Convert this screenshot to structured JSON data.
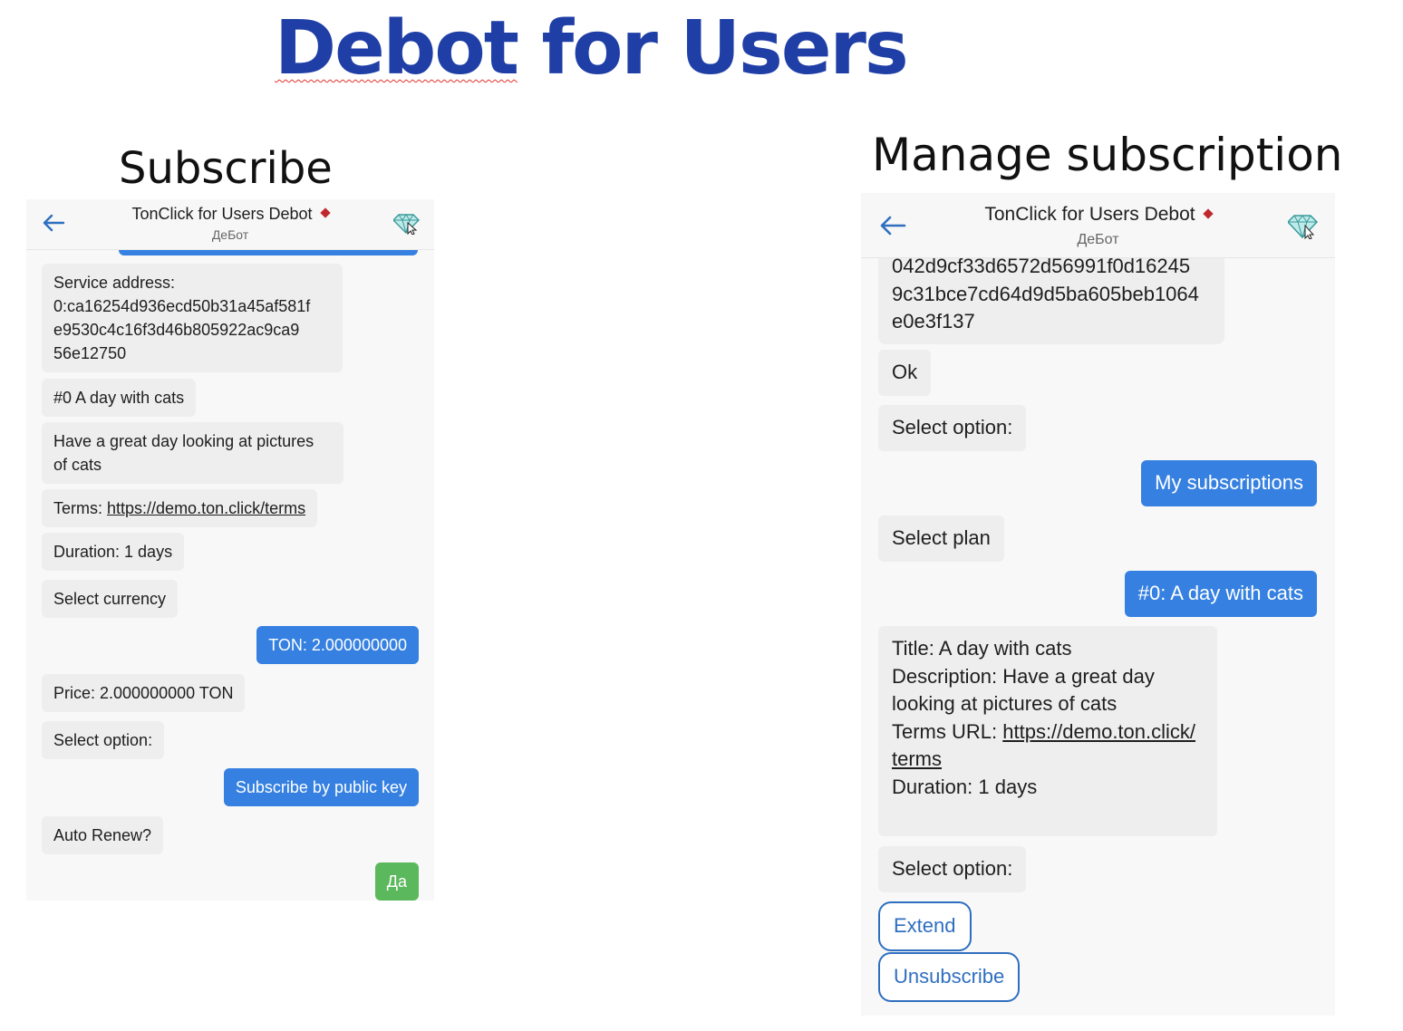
{
  "page_title": {
    "part1": "Debot",
    "part2": " for Users"
  },
  "sections": {
    "subscribe": "Subscribe",
    "manage": "Manage subscription"
  },
  "app": {
    "title": "TonClick for Users Debot",
    "subtitle": "ДеБот",
    "icons": [
      "back-arrow-icon",
      "diamond-icon",
      "gem-icon"
    ],
    "colors": {
      "user_bubble": "#3580e0",
      "bot_bubble": "#eeeeee",
      "confirm_bubble": "#5cb85c",
      "diamond": "#c0282d",
      "title": "#1f3fa6"
    }
  },
  "left_chat": {
    "service_address": [
      "Service address:",
      "0:ca16254d936ecd50b31a45af581f",
      "e9530c4c16f3d46b805922ac9ca9",
      "56e12750"
    ],
    "plan_name": "#0 A day with cats",
    "plan_desc": [
      "Have a great day looking at pictures",
      "of cats"
    ],
    "terms_label": "Terms: ",
    "terms_url": "https://demo.ton.click/terms",
    "duration": "Duration: 1 days",
    "select_currency": "Select currency",
    "currency_choice": "TON: 2.000000000",
    "price": "Price: 2.000000000 TON",
    "select_option": "Select option:",
    "subscribe_choice": "Subscribe by public key",
    "auto_renew": "Auto Renew?",
    "yes_choice": "Да"
  },
  "right_chat": {
    "address_tail": [
      "042d9cf33d6572d56991f0d16245",
      "9c31bce7cd64d9d5ba605beb1064",
      "e0e3f137"
    ],
    "ok": "Ok",
    "select_option_1": "Select option:",
    "my_subscriptions": "My subscriptions",
    "select_plan": "Select plan",
    "plan_choice": "#0: A day with cats",
    "details_title": "Title: A day with cats",
    "details_desc": [
      "Description: Have a great day",
      "looking at pictures of cats"
    ],
    "details_terms_label": "Terms URL: ",
    "details_terms_url": [
      "https://demo.ton.click/",
      "terms"
    ],
    "details_duration": "Duration: 1 days",
    "select_option_2": "Select option:",
    "extend": "Extend",
    "unsubscribe": "Unsubscribe"
  }
}
